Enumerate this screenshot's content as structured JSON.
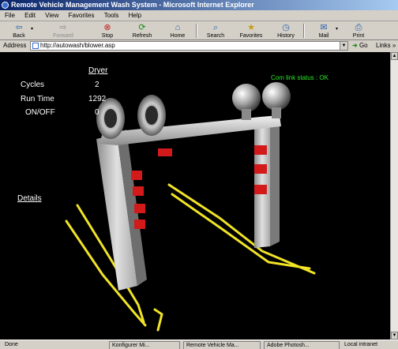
{
  "window": {
    "title": "Remote Vehicle Management Wash System - Microsoft Internet Explorer"
  },
  "menu": [
    "File",
    "Edit",
    "View",
    "Favorites",
    "Tools",
    "Help"
  ],
  "toolbar": {
    "back": "Back",
    "forward": "Forward",
    "stop": "Stop",
    "refresh": "Refresh",
    "home": "Home",
    "search": "Search",
    "favorites": "Favorites",
    "history": "History",
    "mail": "Mail",
    "print": "Print"
  },
  "address": {
    "label": "Address",
    "url": "http://autowash/blower.asp",
    "go": "Go",
    "links": "Links"
  },
  "panel": {
    "title": "Dryer",
    "rows": [
      {
        "label": "Cycles",
        "value": "2"
      },
      {
        "label": "Run Time",
        "value": "1292"
      },
      {
        "label": "ON/OFF",
        "value": "0"
      }
    ],
    "status": "Com link status : OK",
    "details": "Details"
  },
  "statusbar": {
    "done": "Done",
    "zone": "Local intranet"
  },
  "taskbar": [
    "Konfigurer Mi...",
    "Remote Vehicle Ma...",
    "Adobe Photosh..."
  ],
  "colors": {
    "status_ok": "#27e827",
    "rail": "#f1e326",
    "nozzle": "#d21a1a"
  }
}
